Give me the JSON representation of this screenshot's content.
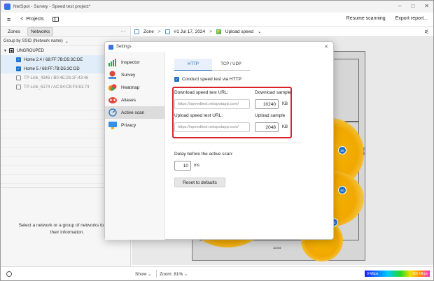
{
  "window": {
    "title": "NetSpot - Survey - Speed test project*",
    "minimize": "–",
    "maximize": "□",
    "close": "✕"
  },
  "toolbar": {
    "menu": "≡",
    "back": "<",
    "projects": "Projects",
    "resume": "Resume scanning",
    "export": "Export report..."
  },
  "left_panel": {
    "tabs": [
      {
        "label": "Zones"
      },
      {
        "label": "Networks"
      }
    ],
    "more": "···",
    "group_by": "Group by SSID (Network name)",
    "group_by_caret": "⌄",
    "group_name": "UNGROUPED",
    "networks": [
      {
        "label": "Home 2.4 / 68:FF:7B:D5:3C:DE"
      },
      {
        "label": "Home 5 / 68:FF:7B:D5:3C:DD"
      },
      {
        "label": "TP-Link_4346 / B0:4E:26:1F:43:46"
      },
      {
        "label": "TP-Link_6174 / AC:84:C6:F3:61:74"
      }
    ],
    "hint": "Select a network or a group of networks to show their information."
  },
  "breadcrumb": {
    "zone": "Zone",
    "sep1": ">",
    "snapshot": "#1 Jul 17, 2024",
    "sep2": ">",
    "visualization": "Upload speed",
    "caret": "⌄",
    "filter": "⚟"
  },
  "floor": {
    "ap_labels": [
      "85",
      "60",
      "63"
    ],
    "dim_right": "10.73",
    "dim_bottom": "10.54"
  },
  "status": {
    "show": "Show  ⌄",
    "zoom": "Zoom: 81%  ⌄",
    "legend_min": "0 Mbps",
    "legend_max": "100 Mbps"
  },
  "settings": {
    "title": "Settings",
    "close": "✕",
    "nav": [
      {
        "label": "Inspector"
      },
      {
        "label": "Survey"
      },
      {
        "label": "Heatmap"
      },
      {
        "label": "Aliases"
      },
      {
        "label": "Active scan"
      },
      {
        "label": "Privacy"
      }
    ],
    "tabs": [
      {
        "label": "HTTP"
      },
      {
        "label": "TCP / UDP"
      }
    ],
    "conduct_label": "Conduct speed test via HTTP",
    "download_url_label": "Download speed test URL:",
    "download_sample_label": "Download sample",
    "download_url_placeholder": "https://speedtest.netspotapp.com/",
    "download_sample_value": "10240",
    "download_unit": "KB",
    "upload_url_label": "Upload speed test URL:",
    "upload_sample_label": "Upload sample",
    "upload_url_placeholder": "https://speedtest.netspotapp.com/",
    "upload_sample_value": "2048",
    "upload_unit": "KB",
    "delay_label": "Delay before the active scan:",
    "delay_value": "10",
    "delay_unit": "ms",
    "reset_label": "Reset to defaults"
  }
}
